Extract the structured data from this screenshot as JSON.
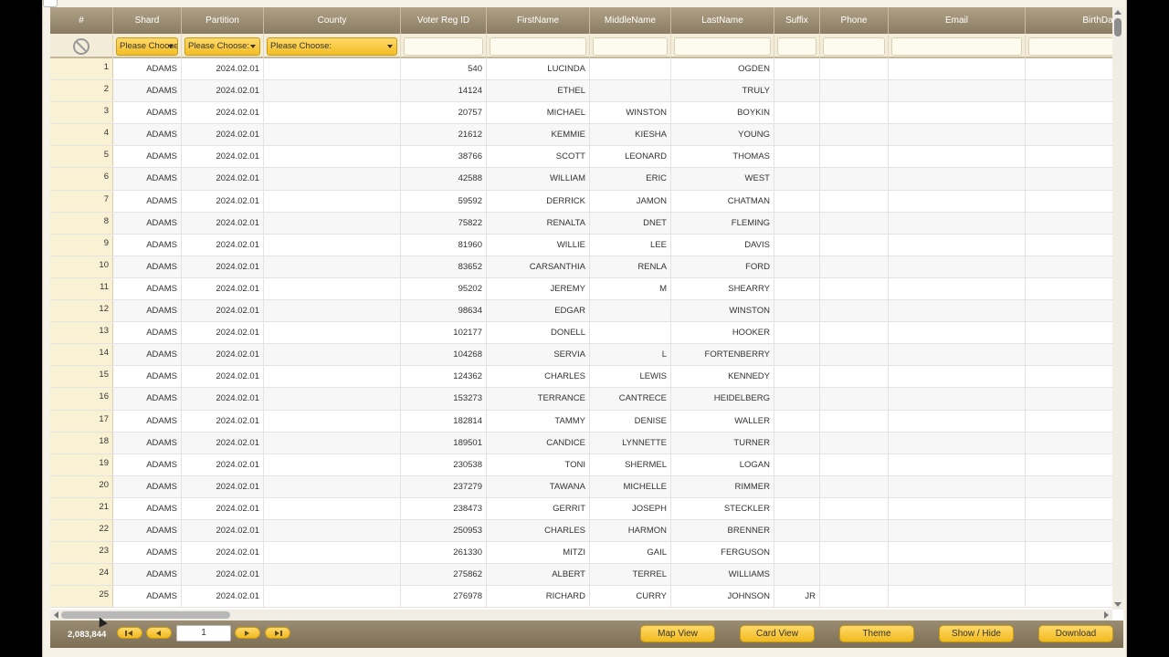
{
  "columns": [
    {
      "label": "#",
      "filter": "clear"
    },
    {
      "label": "Shard",
      "filter": "select",
      "placeholder": "Please Choose:"
    },
    {
      "label": "Partition",
      "filter": "select",
      "placeholder": "Please Choose:"
    },
    {
      "label": "County",
      "filter": "select",
      "placeholder": "Please Choose:"
    },
    {
      "label": "Voter Reg ID",
      "filter": "text"
    },
    {
      "label": "FirstName",
      "filter": "text"
    },
    {
      "label": "MiddleName",
      "filter": "text"
    },
    {
      "label": "LastName",
      "filter": "text"
    },
    {
      "label": "Suffix",
      "filter": "text"
    },
    {
      "label": "Phone",
      "filter": "text"
    },
    {
      "label": "Email",
      "filter": "text"
    },
    {
      "label": "BirthDate",
      "filter": "text"
    }
  ],
  "rows": [
    [
      "1",
      "ADAMS",
      "2024.02.01",
      "",
      "540",
      "LUCINDA",
      "",
      "OGDEN",
      "",
      "",
      "",
      ""
    ],
    [
      "2",
      "ADAMS",
      "2024.02.01",
      "",
      "14124",
      "ETHEL",
      "",
      "TRULY",
      "",
      "",
      "",
      ""
    ],
    [
      "3",
      "ADAMS",
      "2024.02.01",
      "",
      "20757",
      "MICHAEL",
      "WINSTON",
      "BOYKIN",
      "",
      "",
      "",
      ""
    ],
    [
      "4",
      "ADAMS",
      "2024.02.01",
      "",
      "21612",
      "KEMMIE",
      "KIESHA",
      "YOUNG",
      "",
      "",
      "",
      ""
    ],
    [
      "5",
      "ADAMS",
      "2024.02.01",
      "",
      "38766",
      "SCOTT",
      "LEONARD",
      "THOMAS",
      "",
      "",
      "",
      ""
    ],
    [
      "6",
      "ADAMS",
      "2024.02.01",
      "",
      "42588",
      "WILLIAM",
      "ERIC",
      "WEST",
      "",
      "",
      "",
      ""
    ],
    [
      "7",
      "ADAMS",
      "2024.02.01",
      "",
      "59592",
      "DERRICK",
      "JAMON",
      "CHATMAN",
      "",
      "",
      "",
      ""
    ],
    [
      "8",
      "ADAMS",
      "2024.02.01",
      "",
      "75822",
      "RENALTA",
      "DNET",
      "FLEMING",
      "",
      "",
      "",
      ""
    ],
    [
      "9",
      "ADAMS",
      "2024.02.01",
      "",
      "81960",
      "WILLIE",
      "LEE",
      "DAVIS",
      "",
      "",
      "",
      ""
    ],
    [
      "10",
      "ADAMS",
      "2024.02.01",
      "",
      "83652",
      "CARSANTHIA",
      "RENLA",
      "FORD",
      "",
      "",
      "",
      ""
    ],
    [
      "11",
      "ADAMS",
      "2024.02.01",
      "",
      "95202",
      "JEREMY",
      "M",
      "SHEARRY",
      "",
      "",
      "",
      ""
    ],
    [
      "12",
      "ADAMS",
      "2024.02.01",
      "",
      "98634",
      "EDGAR",
      "",
      "WINSTON",
      "",
      "",
      "",
      ""
    ],
    [
      "13",
      "ADAMS",
      "2024.02.01",
      "",
      "102177",
      "DONELL",
      "",
      "HOOKER",
      "",
      "",
      "",
      ""
    ],
    [
      "14",
      "ADAMS",
      "2024.02.01",
      "",
      "104268",
      "SERVIA",
      "L",
      "FORTENBERRY",
      "",
      "",
      "",
      ""
    ],
    [
      "15",
      "ADAMS",
      "2024.02.01",
      "",
      "124362",
      "CHARLES",
      "LEWIS",
      "KENNEDY",
      "",
      "",
      "",
      ""
    ],
    [
      "16",
      "ADAMS",
      "2024.02.01",
      "",
      "153273",
      "TERRANCE",
      "CANTRECE",
      "HEIDELBERG",
      "",
      "",
      "",
      ""
    ],
    [
      "17",
      "ADAMS",
      "2024.02.01",
      "",
      "182814",
      "TAMMY",
      "DENISE",
      "WALLER",
      "",
      "",
      "",
      ""
    ],
    [
      "18",
      "ADAMS",
      "2024.02.01",
      "",
      "189501",
      "CANDICE",
      "LYNNETTE",
      "TURNER",
      "",
      "",
      "",
      ""
    ],
    [
      "19",
      "ADAMS",
      "2024.02.01",
      "",
      "230538",
      "TONI",
      "SHERMEL",
      "LOGAN",
      "",
      "",
      "",
      ""
    ],
    [
      "20",
      "ADAMS",
      "2024.02.01",
      "",
      "237279",
      "TAWANA",
      "MICHELLE",
      "RIMMER",
      "",
      "",
      "",
      ""
    ],
    [
      "21",
      "ADAMS",
      "2024.02.01",
      "",
      "238473",
      "GERRIT",
      "JOSEPH",
      "STECKLER",
      "",
      "",
      "",
      ""
    ],
    [
      "22",
      "ADAMS",
      "2024.02.01",
      "",
      "250953",
      "CHARLES",
      "HARMON",
      "BRENNER",
      "",
      "",
      "",
      ""
    ],
    [
      "23",
      "ADAMS",
      "2024.02.01",
      "",
      "261330",
      "MITZI",
      "GAIL",
      "FERGUSON",
      "",
      "",
      "",
      ""
    ],
    [
      "24",
      "ADAMS",
      "2024.02.01",
      "",
      "275862",
      "ALBERT",
      "TERREL",
      "WILLIAMS",
      "",
      "",
      "",
      ""
    ],
    [
      "25",
      "ADAMS",
      "2024.02.01",
      "",
      "276978",
      "RICHARD",
      "CURRY",
      "JOHNSON",
      "JR",
      "",
      "",
      ""
    ]
  ],
  "footer": {
    "record_count": "2,083,844",
    "page_value": "1",
    "buttons": [
      "Map View",
      "Card View",
      "Theme",
      "Show / Hide",
      "Download"
    ]
  },
  "icons": {
    "clear_filters": "no-entry-icon",
    "nav_first": "first-page-icon",
    "nav_prev": "prev-page-icon",
    "nav_next": "next-page-icon",
    "nav_last": "last-page-icon"
  },
  "colors": {
    "header_bg": "#9b8d72",
    "accent_button": "#f3be25",
    "index_column_bg": "#f9f1d3"
  }
}
